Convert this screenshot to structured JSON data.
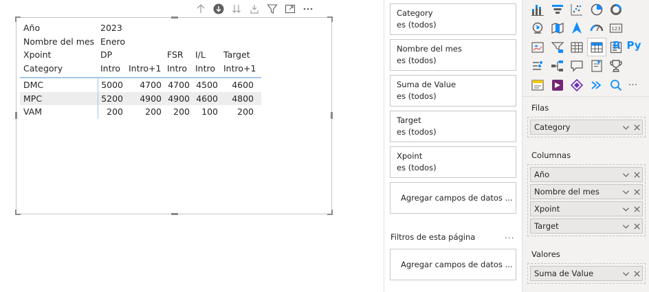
{
  "matrix": {
    "header_rows": [
      {
        "label": "Año",
        "cols": [
          "2023",
          "",
          "",
          "",
          ""
        ]
      },
      {
        "label": "Nombre del mes",
        "cols": [
          "Enero",
          "",
          "",
          "",
          ""
        ]
      },
      {
        "label": "Xpoint",
        "cols": [
          "DP",
          "",
          "FSR",
          "I/L",
          "Target"
        ]
      },
      {
        "label": "Category",
        "cols": [
          "Intro",
          "Intro+1",
          "Intro",
          "Intro",
          "Intro+1"
        ]
      }
    ],
    "rows": [
      {
        "category": "DMC",
        "values": [
          "5000",
          "4700",
          "4700",
          "4500",
          "4600"
        ]
      },
      {
        "category": "MPC",
        "values": [
          "5200",
          "4900",
          "4900",
          "4600",
          "4800"
        ]
      },
      {
        "category": "VAM",
        "values": [
          "200",
          "200",
          "200",
          "100",
          "200"
        ]
      }
    ]
  },
  "toolbar_icons": [
    "arrow-up-icon",
    "drill-down-circle-icon",
    "double-arrow-down-icon",
    "expand-hierarchy-icon",
    "filter-icon",
    "focus-mode-icon",
    "more-options-icon"
  ],
  "filters": {
    "cards": [
      {
        "name": "Category",
        "value": "es (todos)"
      },
      {
        "name": "Nombre del mes",
        "value": "es (todos)"
      },
      {
        "name": "Suma de Value",
        "value": "es (todos)"
      },
      {
        "name": "Target",
        "value": "es (todos)"
      },
      {
        "name": "Xpoint",
        "value": "es (todos)"
      }
    ],
    "add_fields_label": "Agregar campos de datos ...",
    "page_filters_title": "Filtros de esta página",
    "page_filters_more": "...",
    "page_add_fields_label": "Agregar campos de datos ..."
  },
  "viz": {
    "icons": [
      [
        "stacked-column-icon",
        "funnel-icon",
        "scatter-icon",
        "pie-icon",
        "donut-icon"
      ],
      [
        "globe-map-icon",
        "filled-map-icon",
        "azure-map-icon",
        "gauge-icon",
        "card-123-icon"
      ],
      [
        "kpi-icon",
        "slicer-icon",
        "table-icon",
        "matrix-icon",
        "multirow-card-icon"
      ],
      [
        "key-influencers-icon",
        "decomposition-tree-icon",
        "qa-icon",
        "smart-narrative-icon",
        "metrics-icon"
      ],
      [
        "paginated-report-icon",
        "power-apps-icon",
        "power-automate-icon",
        "smart-arrow-icon",
        "search-icon",
        "more-icon"
      ]
    ],
    "r_label": "R",
    "py_label": "Py",
    "card_label": "123",
    "more_label": "···",
    "wells": {
      "rows_title": "Filas",
      "rows": [
        "Category"
      ],
      "columns_title": "Columnas",
      "columns": [
        "Año",
        "Nombre del mes",
        "Xpoint",
        "Target"
      ],
      "values_title": "Valores",
      "values": [
        "Suma de Value"
      ]
    }
  },
  "colors": {
    "accent": "#118dff",
    "header_rule": "#a3c6e8",
    "row_shade": "#ededed",
    "pane_bg": "#f3f2f1"
  }
}
